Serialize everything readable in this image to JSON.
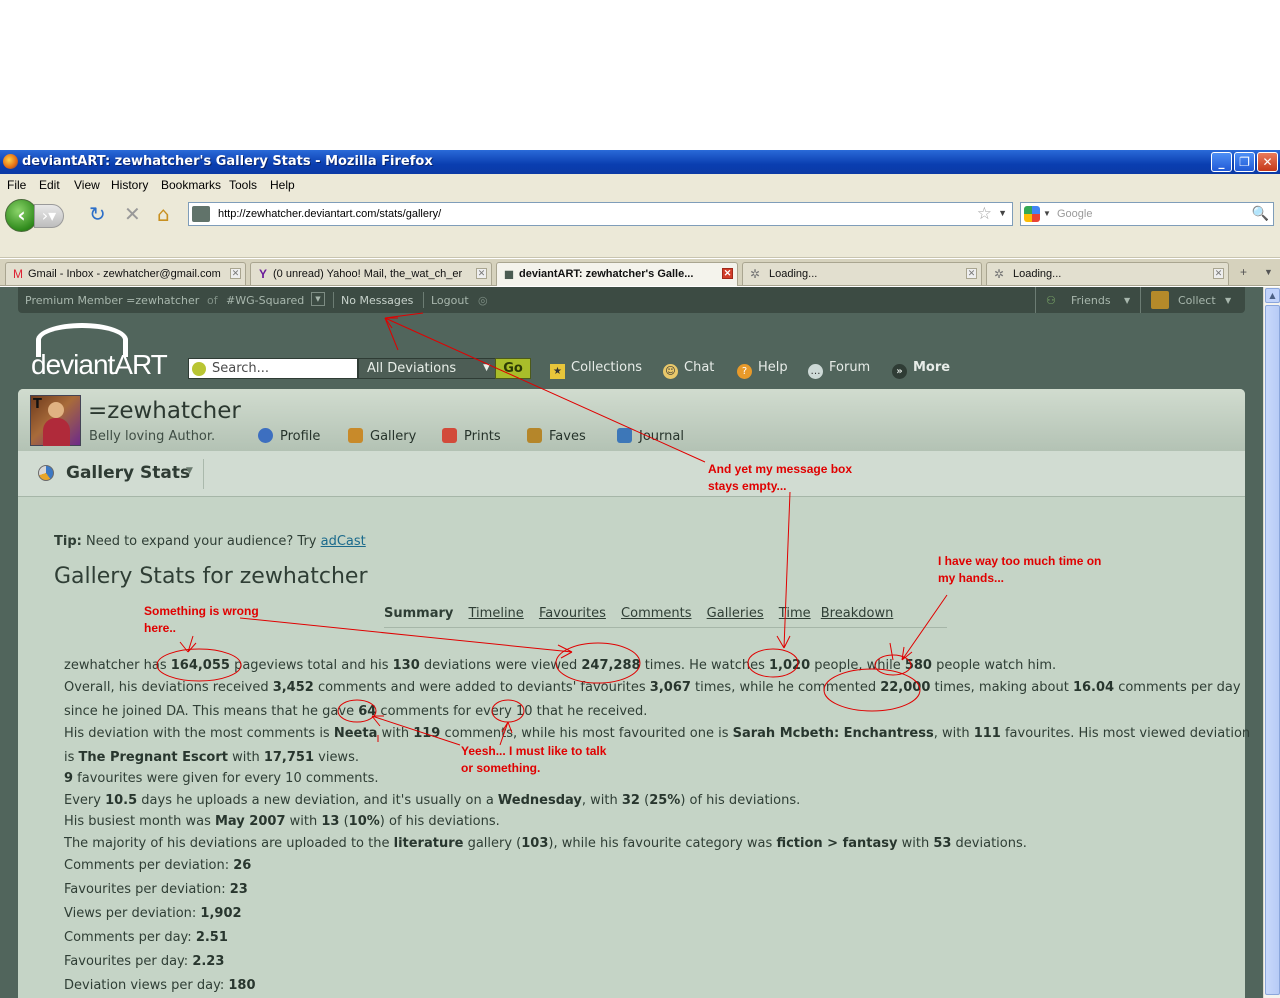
{
  "window": {
    "title": "deviantART: zewhatcher's Gallery Stats - Mozilla Firefox",
    "controls": [
      "_",
      "❐",
      "✕"
    ]
  },
  "menu": [
    "File",
    "Edit",
    "View",
    "History",
    "Bookmarks",
    "Tools",
    "Help"
  ],
  "navbar": {
    "url": "http://zewhatcher.deviantart.com/stats/gallery/",
    "search_placeholder": "Google"
  },
  "tabs": [
    {
      "label": "Gmail - Inbox - zewhatcher@gmail.com",
      "icon": "gmail-icon"
    },
    {
      "label": "(0 unread) Yahoo! Mail, the_wat_ch_er",
      "icon": "yahoo-icon"
    },
    {
      "label": "deviantART: zewhatcher's Galle...",
      "icon": "deviantart-icon",
      "active": true
    },
    {
      "label": "Loading...",
      "icon": "loading-icon"
    },
    {
      "label": "Loading...",
      "icon": "loading-icon"
    }
  ],
  "topstrip": {
    "member": "Premium Member =zewhatcher",
    "of": "of",
    "group": "#WG-Squared",
    "messages": "No Messages",
    "logout": "Logout",
    "friends": "Friends",
    "collect": "Collect"
  },
  "header": {
    "logo": "deviantART",
    "search_placeholder": "Search...",
    "scope": "All Deviations",
    "go": "Go",
    "nav": [
      "Collections",
      "Chat",
      "Help",
      "Forum",
      "More"
    ]
  },
  "profile": {
    "name": "=zewhatcher",
    "tagline": "Belly loving Author.",
    "tabs": [
      "Profile",
      "Gallery",
      "Prints",
      "Faves",
      "Journal"
    ]
  },
  "section_title": "Gallery Stats",
  "tip": {
    "label": "Tip:",
    "text": "Need to expand your audience? Try",
    "link": "adCast"
  },
  "heading": "Gallery Stats for zewhatcher",
  "subnav": [
    "Summary",
    "Timeline",
    "Favourites",
    "Comments",
    "Galleries",
    "Time",
    "Breakdown"
  ],
  "stats": {
    "pageviews": "164,055",
    "deviations": "130",
    "deviation_views": "247,288",
    "watches": "1,020",
    "watchers": "580",
    "comments_received": "3,452",
    "favourited": "3,067",
    "commented": "22,000",
    "comments_per_day": "16.04",
    "gave_ratio": "64",
    "received_ratio": "10",
    "most_comments_deviation": "Neeta",
    "most_comments_count": "119",
    "most_faved": "Sarah Mcbeth: Enchantress",
    "most_faved_count": "111",
    "most_viewed": "The Pregnant Escort",
    "most_viewed_count": "17,751",
    "fav_per_10": "9",
    "upload_days": "10.5",
    "weekday": "Wednesday",
    "weekday_count": "32",
    "weekday_pct": "25%",
    "busiest_month": "May 2007",
    "busiest_count": "13",
    "busiest_pct": "10%",
    "gallery": "literature",
    "gallery_count": "103",
    "fav_category": "fiction > fantasy",
    "fav_category_count": "53",
    "comments_per_deviation": "26",
    "favourites_per_deviation": "23",
    "views_per_deviation": "1,902",
    "comments_per_day_2": "2.51",
    "favourites_per_day": "2.23",
    "deviation_views_per_day": "180"
  },
  "annotations": {
    "message_note": "And yet my message box stays empty...",
    "wrong_note": "Something is wrong here..",
    "time_note": "I have way too much time on my hands...",
    "talk_note": "Yeesh... I must like to talk or something."
  },
  "colors": {
    "annotation": "#e00000",
    "da_bg": "#51655c",
    "content_bg": "#c5d4c6"
  }
}
